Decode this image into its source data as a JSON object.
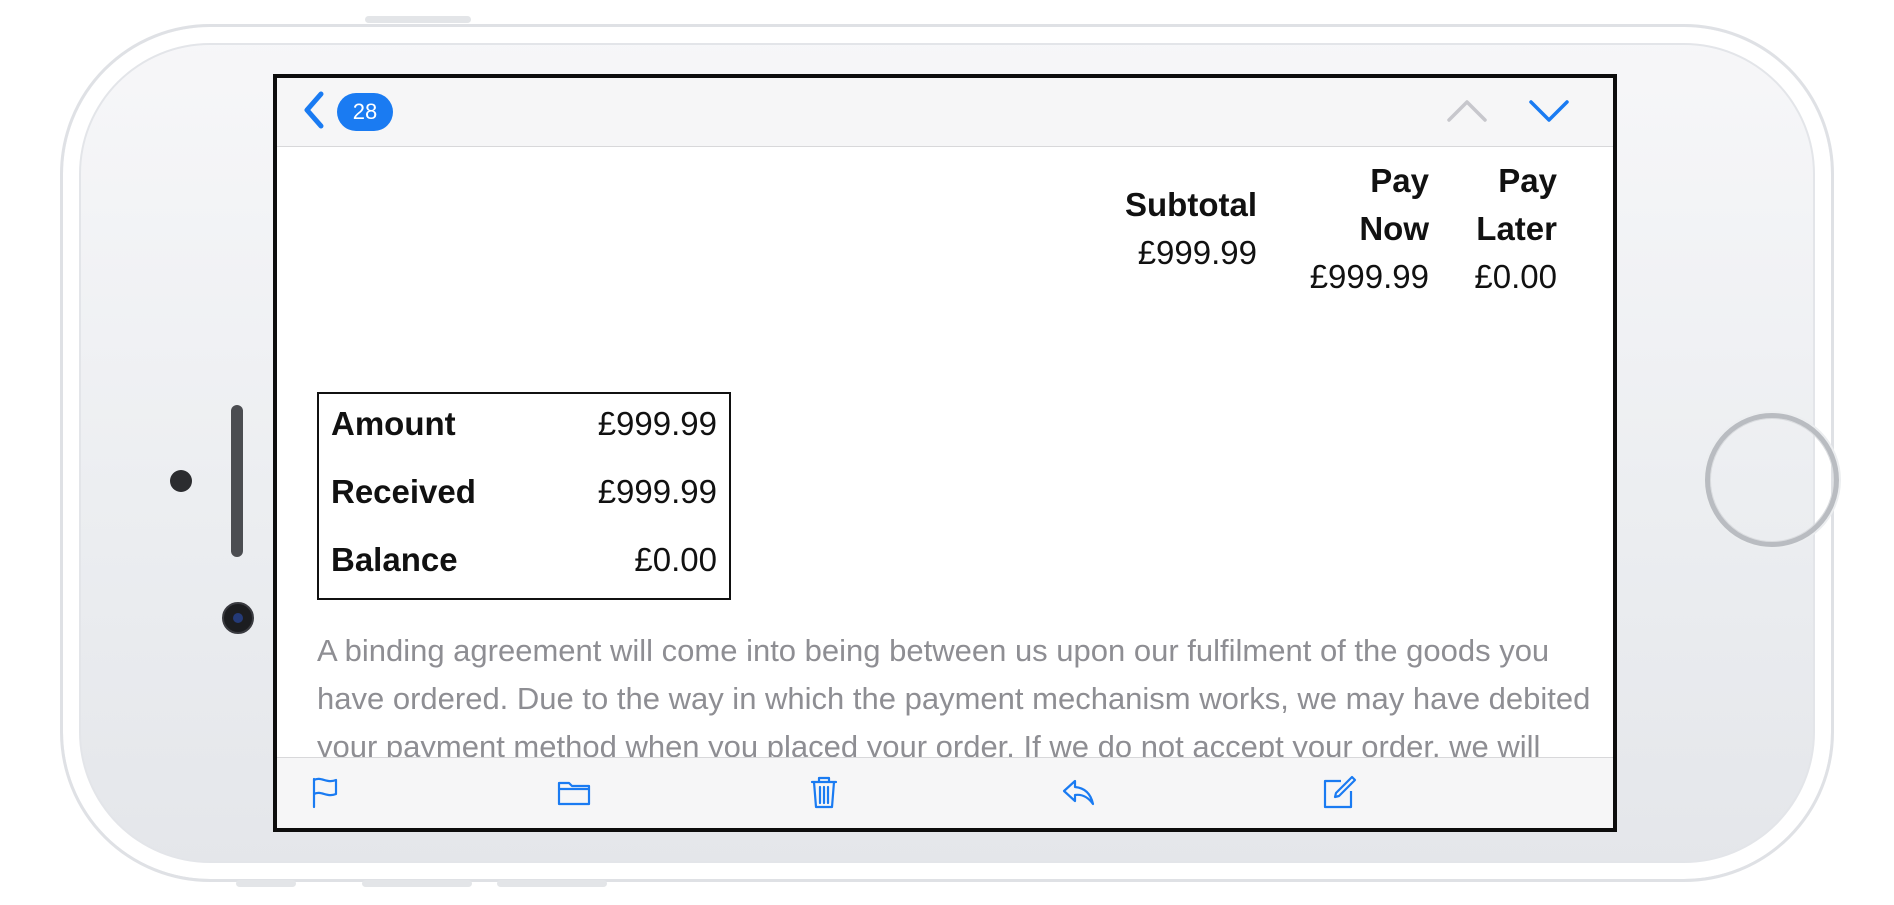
{
  "navbar": {
    "back_count": "28",
    "accent_color": "#1a7bf2",
    "icons": [
      "chevron-left-icon",
      "chevron-up-icon",
      "chevron-down-icon"
    ]
  },
  "totals": {
    "subtotal": {
      "header": "Subtotal",
      "value": "£999.99"
    },
    "pay_now": {
      "header_line1": "Pay",
      "header_line2": "Now",
      "value": "£999.99"
    },
    "pay_later": {
      "header_line1": "Pay",
      "header_line2": "Later",
      "value": "£0.00"
    }
  },
  "summary": {
    "rows": [
      {
        "label": "Amount",
        "value": "£999.99"
      },
      {
        "label": "Received",
        "value": "£999.99"
      },
      {
        "label": "Balance",
        "value": "£0.00"
      }
    ]
  },
  "legal_text": "A binding agreement will come into being between us upon our fulfilment of the goods you have ordered. Due to the way in which the payment mechanism works, we may have debited your payment method when you placed your order. If we do not accept your order, we will promptly refund any payments taken.",
  "toolbar": {
    "icons": [
      "flag-icon",
      "folder-icon",
      "trash-icon",
      "reply-icon",
      "compose-icon"
    ]
  }
}
